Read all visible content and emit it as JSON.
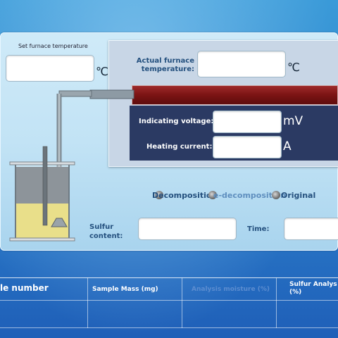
{
  "set_temp": {
    "label": "Set furnace temperature",
    "value": "",
    "unit": "℃"
  },
  "actual_temp": {
    "label": "Actual furnace temperature:",
    "value": "",
    "unit": "℃"
  },
  "voltage": {
    "label": "Indicating voltage:",
    "value": "",
    "unit": "mV"
  },
  "current": {
    "label": "Heating current:",
    "value": "",
    "unit": "A"
  },
  "modes": {
    "options": [
      "Decomposition",
      "Re-decomposition",
      "Original"
    ],
    "visible_labels": [
      "Decomposition",
      "e-decomposition",
      "Original"
    ]
  },
  "sulfur": {
    "label": "Sulfur content:",
    "value": ""
  },
  "time": {
    "label": "Time:",
    "value": ""
  },
  "table": {
    "headers": [
      "le number",
      "Sample Mass (mg)",
      "Analysis moisture (%)",
      "Sulfur Analys (%)"
    ],
    "rows": [
      [
        "",
        "",
        "",
        ""
      ]
    ]
  },
  "colors": {
    "heater": "#7b1414",
    "panel_dark": "#2b3a63",
    "label_blue": "#24507e"
  },
  "icons": [
    "beaker-icon",
    "furnace-tube-icon",
    "radio-icon"
  ]
}
